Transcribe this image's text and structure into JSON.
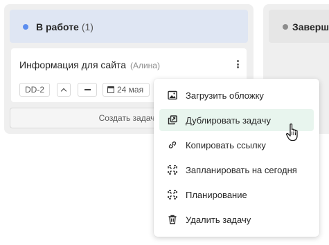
{
  "columns": [
    {
      "title": "В работе",
      "count": "(1)",
      "dot_color": "#5b8def",
      "cards": [
        {
          "title": "Информация для сайта",
          "assignee": "(Алина)",
          "id": "DD-2",
          "date": "24 мая"
        }
      ],
      "create_label": "Создать задачу"
    },
    {
      "title": "Заверше",
      "dot_color": "#8c8c8c"
    }
  ],
  "menu": {
    "active_index": 1,
    "items": [
      {
        "label": "Загрузить обложку",
        "icon": "image-icon"
      },
      {
        "label": "Дублировать задачу",
        "icon": "duplicate-icon"
      },
      {
        "label": "Копировать ссылку",
        "icon": "link-icon"
      },
      {
        "label": "Запланировать на сегодня",
        "icon": "schedule-icon"
      },
      {
        "label": "Планирование",
        "icon": "planning-icon"
      },
      {
        "label": "Удалить задачу",
        "icon": "trash-icon"
      }
    ]
  }
}
